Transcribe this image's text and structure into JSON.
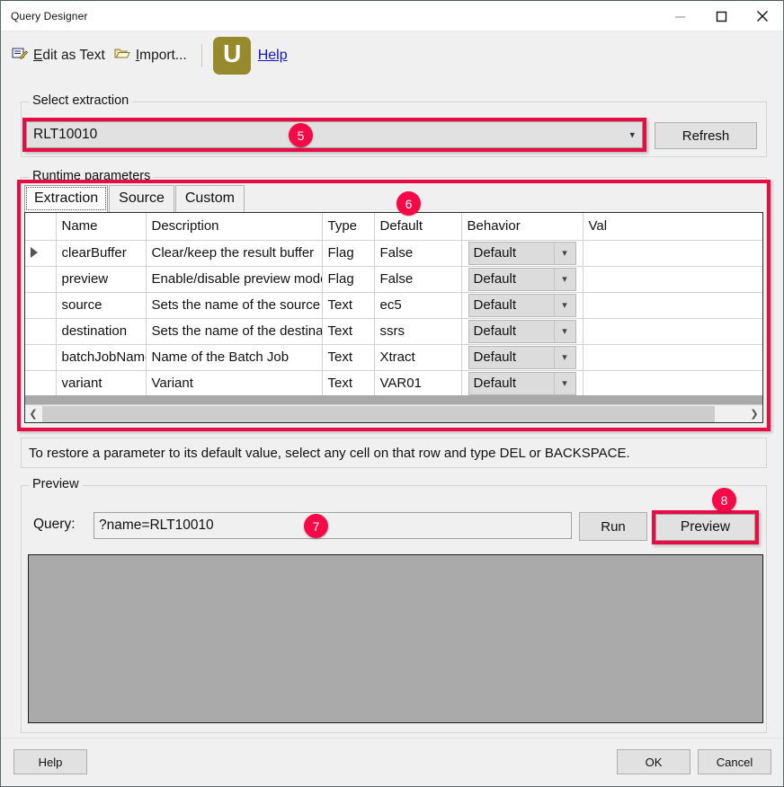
{
  "window": {
    "title": "Query Designer",
    "controls": [
      {
        "name": "minimize",
        "glyph": "minimize-icon"
      },
      {
        "name": "maximize",
        "glyph": "maximize-icon"
      },
      {
        "name": "close",
        "glyph": "close-icon"
      }
    ]
  },
  "toolbar": {
    "edit_as_text": "Edit as Text",
    "edit_as_text_mnemonic": "E",
    "import": "Import...",
    "import_mnemonic": "I",
    "logo_letter": "U",
    "help_link": "Help"
  },
  "select_extraction": {
    "legend": "Select extraction",
    "combo_value": "RLT10010",
    "combo_arrow": "chevron-down-icon",
    "refresh_label": "Refresh"
  },
  "runtime_parameters": {
    "legend": "Runtime parameters",
    "tabs": [
      {
        "label": "Extraction",
        "active": true
      },
      {
        "label": "Source",
        "active": false
      },
      {
        "label": "Custom",
        "active": false
      }
    ],
    "columns": [
      "",
      "Name",
      "Description",
      "Type",
      "Default",
      "Behavior",
      "Val"
    ],
    "rows": [
      {
        "selected": true,
        "name": "clearBuffer",
        "description": "Clear/keep the result buffer",
        "type": "Flag",
        "default": "False",
        "behavior": "Default",
        "value": ""
      },
      {
        "selected": false,
        "name": "preview",
        "description": "Enable/disable preview mode",
        "type": "Flag",
        "default": "False",
        "behavior": "Default",
        "value": ""
      },
      {
        "selected": false,
        "name": "source",
        "description": "Sets the name of the source",
        "type": "Text",
        "default": "ec5",
        "behavior": "Default",
        "value": ""
      },
      {
        "selected": false,
        "name": "destination",
        "description": "Sets the name of the destination",
        "type": "Text",
        "default": "ssrs",
        "behavior": "Default",
        "value": ""
      },
      {
        "selected": false,
        "name": "batchJobName",
        "description": "Name of the Batch Job",
        "type": "Text",
        "default": "Xtract",
        "behavior": "Default",
        "value": ""
      },
      {
        "selected": false,
        "name": "variant",
        "description": "Variant",
        "type": "Text",
        "default": "VAR01",
        "behavior": "Default",
        "value": ""
      }
    ],
    "scroll_left_icon": "chevron-left-icon",
    "scroll_right_icon": "chevron-right-icon"
  },
  "hint": "To restore a parameter to its default value, select any cell on that row and type DEL or BACKSPACE.",
  "preview": {
    "legend": "Preview",
    "query_label": "Query:",
    "query_value": "?name=RLT10010",
    "run_label": "Run",
    "preview_label": "Preview",
    "output_text": ""
  },
  "footer": {
    "help_label": "Help",
    "ok_label": "OK",
    "cancel_label": "Cancel"
  },
  "annotations": [
    {
      "id": "5",
      "label": "5"
    },
    {
      "id": "6",
      "label": "6"
    },
    {
      "id": "7",
      "label": "7"
    },
    {
      "id": "8",
      "label": "8"
    }
  ],
  "colors": {
    "highlight": "#ea0b45",
    "badge": "#f50a47",
    "selection": "#0a7bd4",
    "logo": "#968a2c",
    "link": "#1414cc",
    "preview_panel": "#aaaaaa"
  }
}
